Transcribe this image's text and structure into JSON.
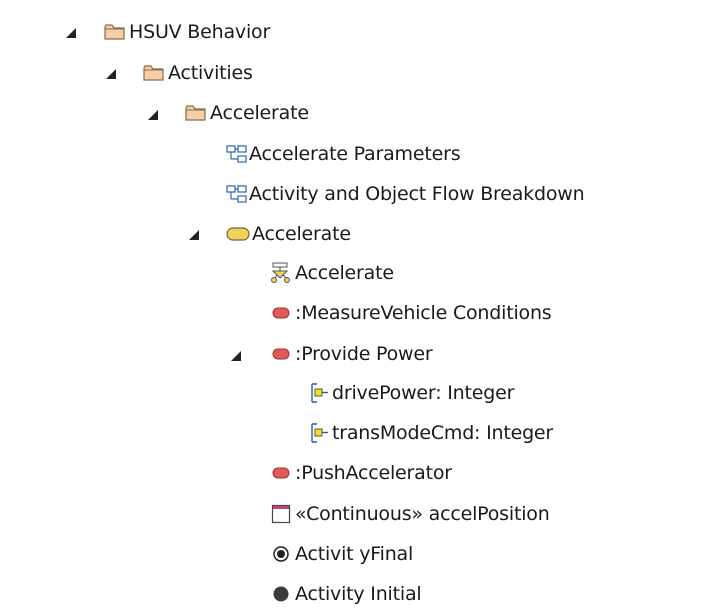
{
  "colors": {
    "folder_fill": "#f6cfa8",
    "folder_stroke": "#8a6a4a",
    "activity_fill": "#f0d060",
    "action_fill": "#e05a5a",
    "pin_fill": "#f2e21f",
    "diagram_stroke": "#3a6fb5",
    "text": "#1a1a1a"
  },
  "tree": [
    {
      "label": "HSUV Behavior",
      "icon": "folder-icon",
      "expanded": true
    },
    {
      "label": "Activities",
      "icon": "folder-icon",
      "expanded": true
    },
    {
      "label": "Accelerate",
      "icon": "folder-icon",
      "expanded": true
    },
    {
      "label": "Accelerate Parameters",
      "icon": "diagram-icon"
    },
    {
      "label": "Activity and Object Flow Breakdown",
      "icon": "diagram-icon"
    },
    {
      "label": "Accelerate",
      "icon": "activity-icon",
      "expanded": true
    },
    {
      "label": "Accelerate",
      "icon": "activity-diagram-icon"
    },
    {
      "label": ":MeasureVehicle Conditions",
      "icon": "action-icon"
    },
    {
      "label": ":Provide Power",
      "icon": "action-icon",
      "expanded": true
    },
    {
      "label": "drivePower: Integer",
      "icon": "pin-icon"
    },
    {
      "label": "transModeCmd: Integer",
      "icon": "pin-icon"
    },
    {
      "label": ":PushAccelerator",
      "icon": "action-icon"
    },
    {
      "label": "«Continuous» accelPosition",
      "icon": "object-node-icon"
    },
    {
      "label": "Activit yFinal",
      "icon": "final-node-icon"
    },
    {
      "label": "Activity Initial",
      "icon": "initial-node-icon"
    }
  ]
}
